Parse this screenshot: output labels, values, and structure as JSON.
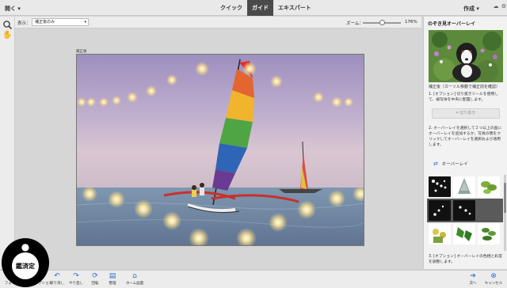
{
  "topbar": {
    "open_label": "開く",
    "tabs": [
      {
        "label": "クイック",
        "active": false
      },
      {
        "label": "ガイド",
        "active": true
      },
      {
        "label": "エキスパート",
        "active": false
      }
    ],
    "create_label": "作成"
  },
  "options": {
    "view_label": "表示：",
    "view_value": "補正後のみ",
    "zoom_label": "ズーム：",
    "zoom_value": "176%",
    "zoom_level": 0.5
  },
  "document": {
    "label": "補正後"
  },
  "panel": {
    "title": "のぞき見オーバーレイ",
    "caption": "補正後（カーソル移動で補正前を確認）",
    "step1": "1. [オプション] 切り抜きツールを使用して、被写体を中央に配置します。",
    "crop_button": "切り抜き",
    "step2": "2. オーバーレイを選択して２つ以上の画にオーバーレイを追加するか、写真の隅をクリックしてオーバーレイを選択および適用します。",
    "overlay_label": "オーバーレイ",
    "step3": "3. [オプション] オーバーレイの色相と彩度を調整します。"
  },
  "bottombar": {
    "items": [
      {
        "label": "フォトビン",
        "icon": "photo-bin-icon"
      },
      {
        "label": "ツールオプション",
        "icon": "tool-options-icon"
      },
      {
        "label": "取り消し",
        "icon": "undo-icon"
      },
      {
        "label": "やり直し",
        "icon": "redo-icon"
      },
      {
        "label": "回転",
        "icon": "rotate-icon"
      },
      {
        "label": "整理",
        "icon": "organize-icon"
      },
      {
        "label": "ホーム画面",
        "icon": "home-icon"
      },
      {
        "label": "次へ",
        "icon": "next-icon"
      },
      {
        "label": "キャンセル",
        "icon": "cancel-icon"
      }
    ]
  },
  "badge": {
    "text": "鑑済定"
  },
  "colors": {
    "accent": "#2f6fd0",
    "active_tab": "#4a4a4a"
  }
}
